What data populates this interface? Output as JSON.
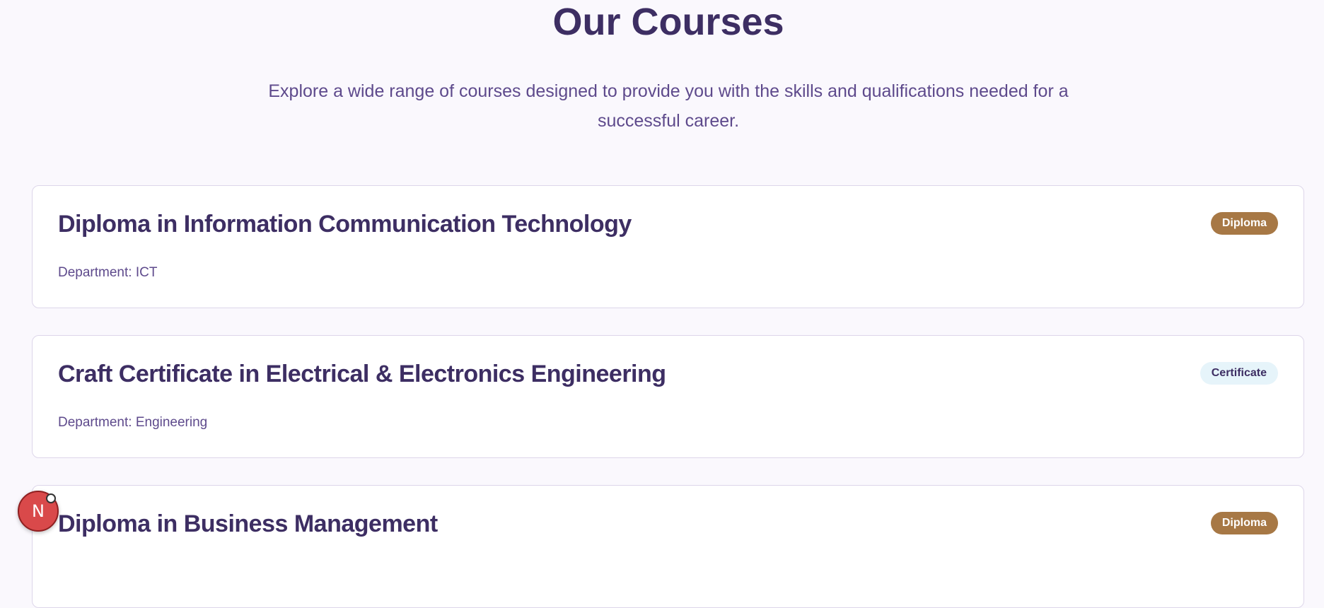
{
  "header": {
    "title": "Our Courses",
    "subtitle": "Explore a wide range of courses designed to provide you with the skills and qualifications needed for a successful career."
  },
  "courses": [
    {
      "title": "Diploma in Information Communication Technology",
      "department": "Department: ICT",
      "badge": "Diploma"
    },
    {
      "title": "Craft Certificate in Electrical & Electronics Engineering",
      "department": "Department: Engineering",
      "badge": "Certificate"
    },
    {
      "title": "Diploma in Business Management",
      "badge": "Diploma"
    }
  ],
  "dev_indicator": {
    "letter": "N"
  },
  "colors": {
    "primary_text": "#3d2e63",
    "diploma_badge": "#a77845",
    "certificate_badge": "#e6f4fa",
    "background": "#faf8fd"
  }
}
